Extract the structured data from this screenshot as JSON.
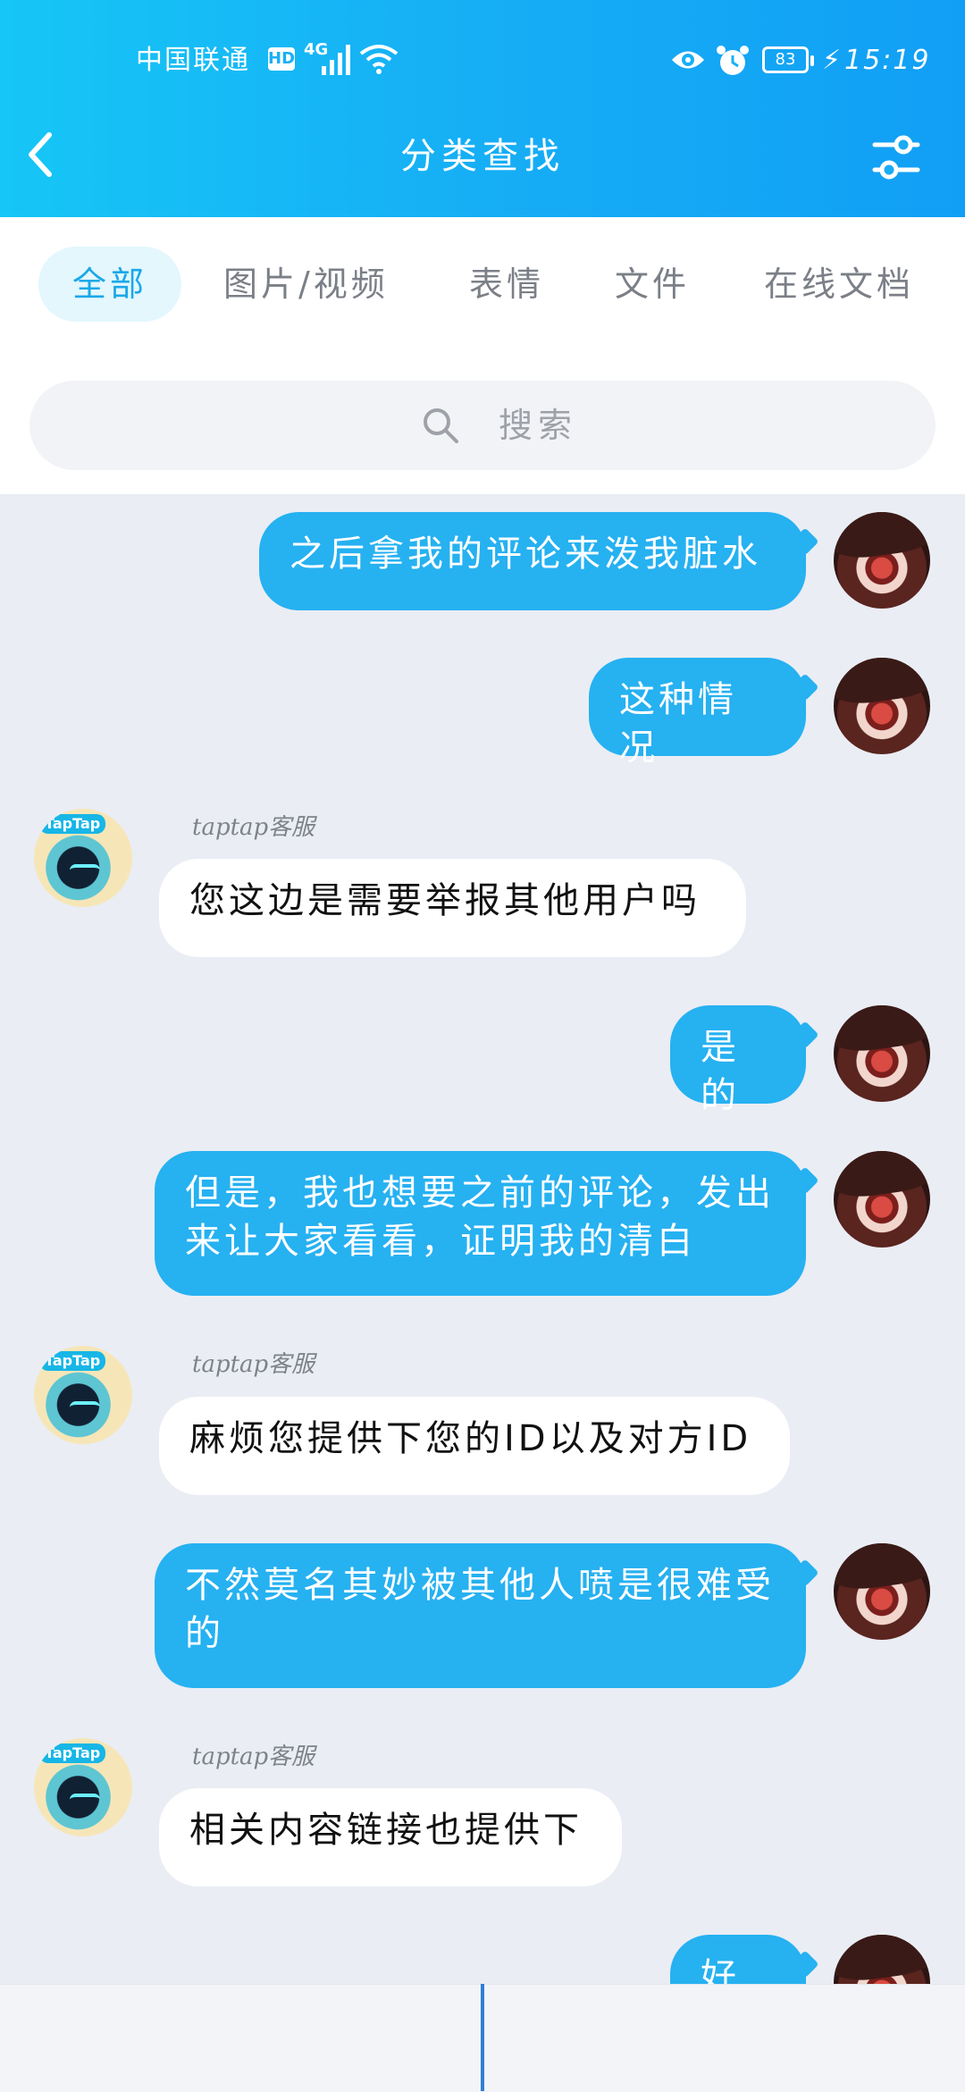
{
  "status": {
    "carrier": "中国联通",
    "hd": "HD",
    "network": "4G",
    "battery": "83",
    "time": "15:19"
  },
  "header": {
    "title": "分类查找"
  },
  "tabs": [
    {
      "label": "全部",
      "active": true
    },
    {
      "label": "图片/视频",
      "active": false
    },
    {
      "label": "表情",
      "active": false
    },
    {
      "label": "文件",
      "active": false
    },
    {
      "label": "在线文档",
      "active": false
    }
  ],
  "search": {
    "placeholder": "搜索"
  },
  "messages": [
    {
      "from": "me",
      "text": "之后拿我的评论来泼我脏水"
    },
    {
      "from": "me",
      "text": "这种情况"
    },
    {
      "from": "them",
      "sender": "taptap客服",
      "badge": "TapTap",
      "text": "您这边是需要举报其他用户吗"
    },
    {
      "from": "me",
      "text": "是的"
    },
    {
      "from": "me",
      "text": "但是，我也想要之前的评论，发出来让大家看看，证明我的清白"
    },
    {
      "from": "them",
      "sender": "taptap客服",
      "badge": "TapTap",
      "text": "麻烦您提供下您的ID以及对方ID"
    },
    {
      "from": "me",
      "text": "不然莫名其妙被其他人喷是很难受的"
    },
    {
      "from": "them",
      "sender": "taptap客服",
      "badge": "TapTap",
      "text": "相关内容链接也提供下"
    },
    {
      "from": "me",
      "text": "好的"
    }
  ],
  "colors": {
    "header_start": "#16c6f6",
    "header_end": "#119ff5",
    "bubble_me": "#26b1f1",
    "bubble_them": "#ffffff",
    "chat_bg": "#eaedf4",
    "tab_active_text": "#1ba8e8",
    "tab_active_bg": "#e3f7fd"
  },
  "icons": {
    "back": "chevron-left-icon",
    "filter": "sliders-icon",
    "search": "search-icon",
    "eye": "eye-icon",
    "alarm": "alarm-icon",
    "wifi": "wifi-icon",
    "signal": "signal-icon",
    "charging": "bolt-icon"
  }
}
